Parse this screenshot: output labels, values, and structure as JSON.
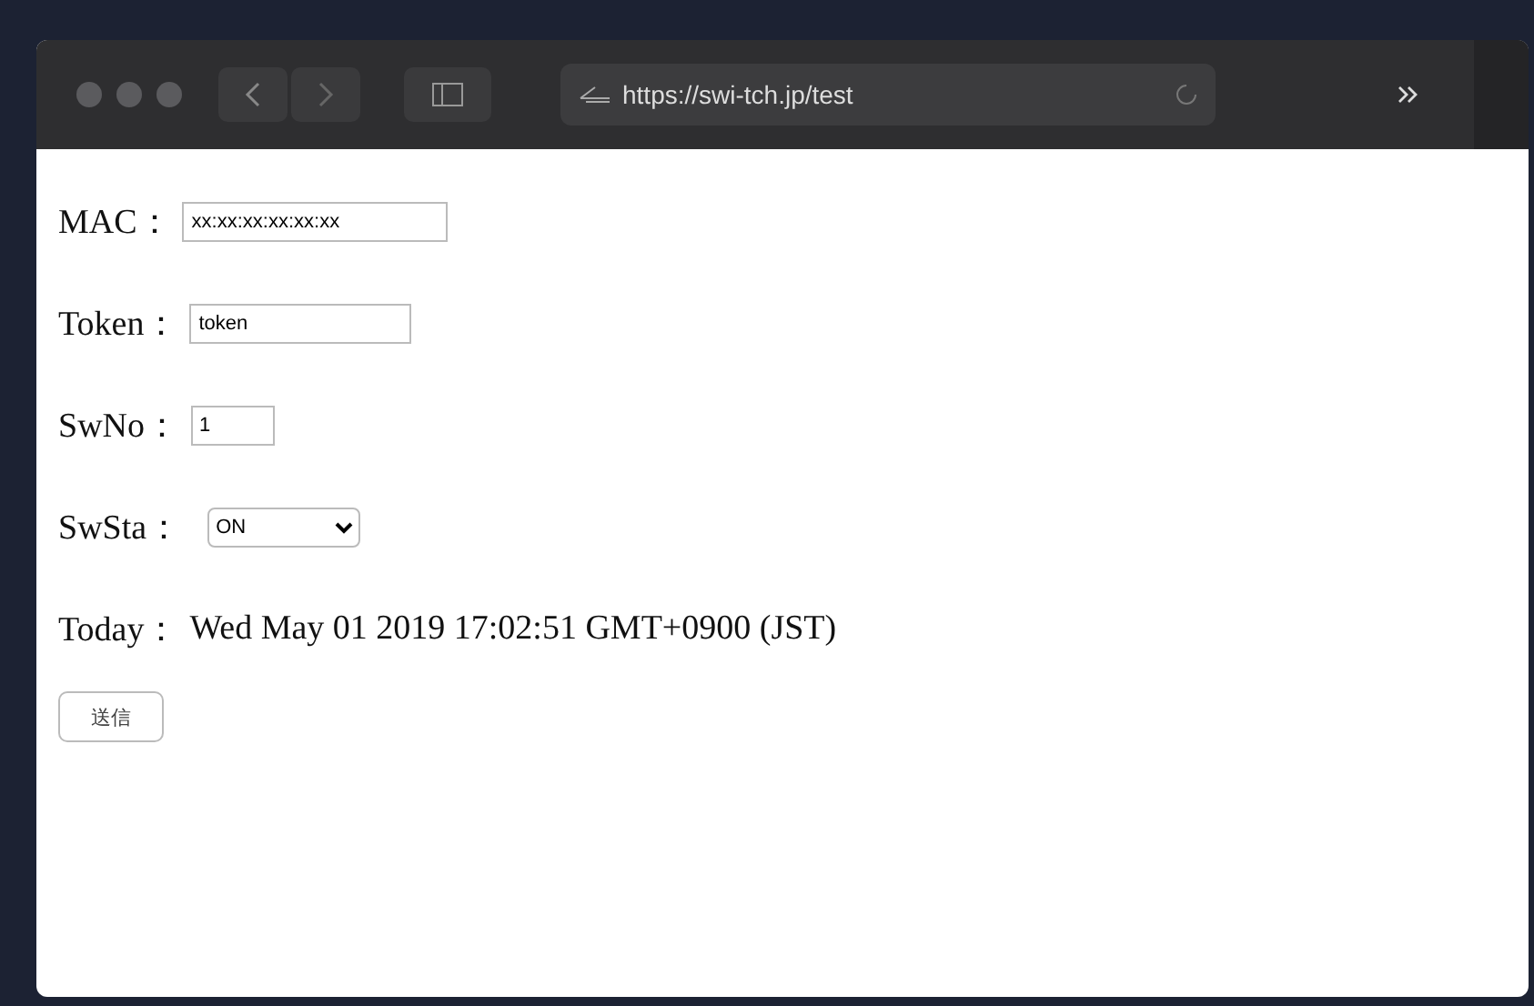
{
  "browser": {
    "url": "https://swi-tch.jp/test"
  },
  "fields": [
    {
      "label": "MAC：",
      "kind": "text",
      "value": "xx:xx:xx:xx:xx:xx"
    },
    {
      "label": "Token：",
      "kind": "text",
      "value": "token"
    },
    {
      "label": "SwNo：",
      "kind": "number",
      "value": "1"
    },
    {
      "label": "SwSta：",
      "kind": "select",
      "value": "ON"
    }
  ],
  "today": {
    "label": "Today：",
    "value": "Wed May 01 2019 17:02:51 GMT+0900 (JST)"
  },
  "submit": "送信"
}
